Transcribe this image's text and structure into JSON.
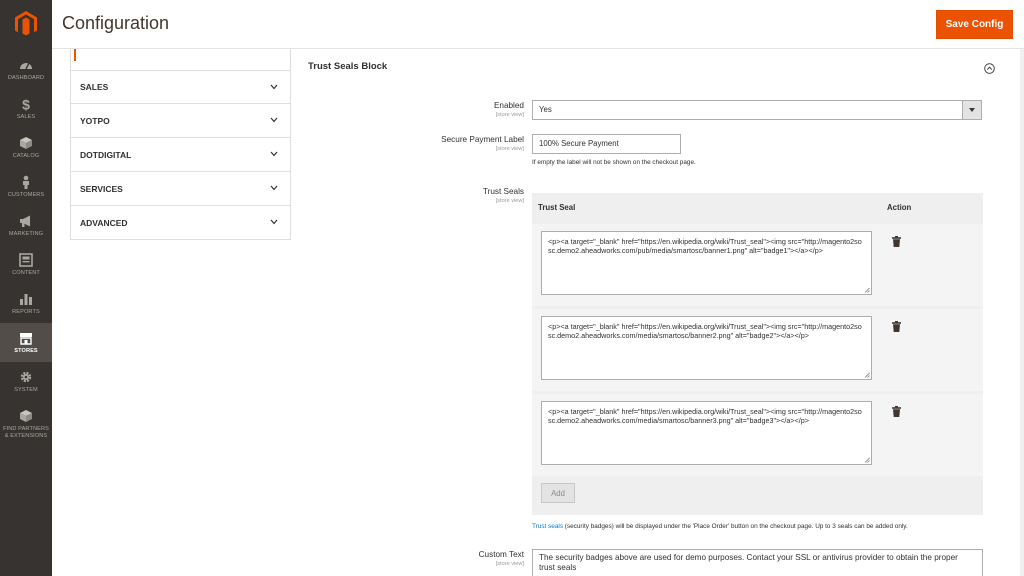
{
  "nav": {
    "items": [
      {
        "label": "DASHBOARD",
        "icon": "dashboard-icon"
      },
      {
        "label": "SALES",
        "icon": "dollar-icon"
      },
      {
        "label": "CATALOG",
        "icon": "cube-icon"
      },
      {
        "label": "CUSTOMERS",
        "icon": "person-icon"
      },
      {
        "label": "MARKETING",
        "icon": "megaphone-icon"
      },
      {
        "label": "CONTENT",
        "icon": "layout-icon"
      },
      {
        "label": "REPORTS",
        "icon": "bar-chart-icon"
      },
      {
        "label": "STORES",
        "icon": "store-icon"
      },
      {
        "label": "SYSTEM",
        "icon": "gear-icon"
      },
      {
        "label": "FIND PARTNERS & EXTENSIONS",
        "icon": "box-icon"
      }
    ],
    "active": "STORES"
  },
  "header": {
    "title": "Configuration",
    "save_label": "Save Config"
  },
  "tabs": [
    "SALES",
    "YOTPO",
    "DOTDIGITAL",
    "SERVICES",
    "ADVANCED"
  ],
  "section": {
    "title": "Trust Seals Block",
    "scope": "[store view]",
    "enabled_label": "Enabled",
    "enabled_value": "Yes",
    "secure_label": "Secure Payment Label",
    "secure_value": "100% Secure Payment",
    "secure_note": "If empty the label will not be shown on the checkout page.",
    "seals_label": "Trust Seals",
    "col_seal": "Trust Seal",
    "col_action": "Action",
    "seals": [
      "<p><a target=\"_blank\" href=\"https://en.wikipedia.org/wiki/Trust_seal\"><img src=\"http://magento2sosc.demo2.aheadworks.com/pub/media/smartosc/banner1.png\"  alt=\"badge1\"></a></p>",
      "<p><a target=\"_blank\" href=\"https://en.wikipedia.org/wiki/Trust_seal\"><img src=\"http://magento2sosc.demo2.aheadworks.com/media/smartosc/banner2.png\" alt=\"badge2\"></a></p>",
      "<p><a target=\"_blank\" href=\"https://en.wikipedia.org/wiki/Trust_seal\"><img src=\"http://magento2sosc.demo2.aheadworks.com/media/smartosc/banner3.png\" alt=\"badge3\"></a></p>"
    ],
    "add_label": "Add",
    "seals_note_link": "Trust seals",
    "seals_note_rest": " (security badges) will be displayed under the 'Place Order' button on the checkout page. Up to 3 seals can be added only.",
    "custom_label": "Custom Text",
    "custom_value": "The security badges above are used for demo purposes. Contact your SSL or antivirus provider to obtain the proper trust seals"
  },
  "colors": {
    "nav_bg": "#373330",
    "nav_active": "#524d49",
    "accent": "#eb5202",
    "link": "#007bdb"
  }
}
